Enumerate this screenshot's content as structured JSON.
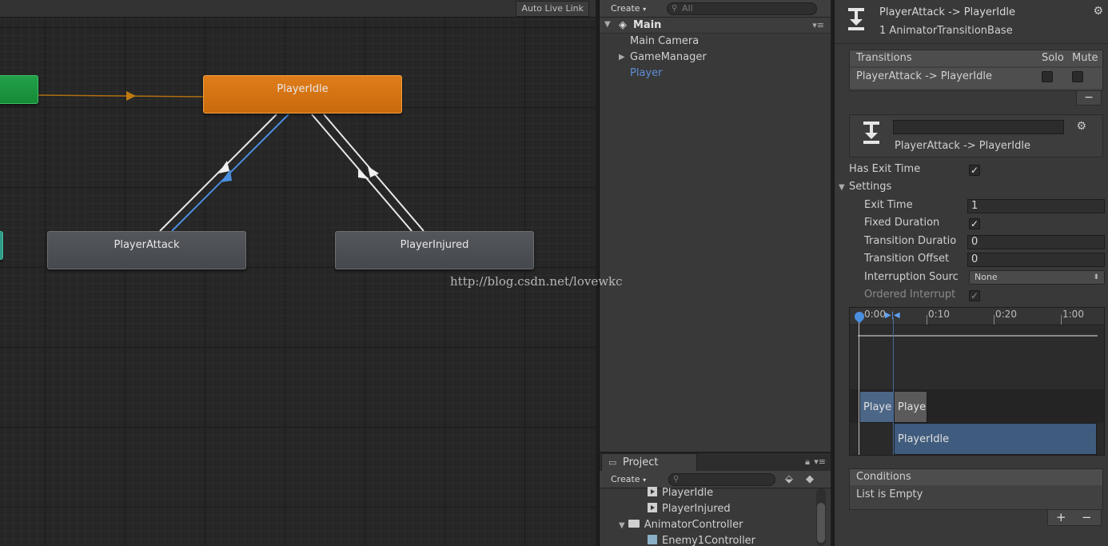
{
  "graph": {
    "auto_live_link": "Auto Live Link",
    "states": {
      "idle": "PlayerIdle",
      "attack": "PlayerAttack",
      "injured": "PlayerInjured"
    }
  },
  "hierarchy": {
    "create": "Create",
    "search_placeholder": "All",
    "scene": "Main",
    "items": [
      "Main Camera",
      "GameManager",
      "Player"
    ]
  },
  "project": {
    "tab": "Project",
    "create": "Create",
    "items": [
      "PlayerIdle",
      "PlayerInjured",
      "AnimatorController",
      "Enemy1Controller"
    ]
  },
  "inspector": {
    "title": "PlayerAttack -> PlayerIdle",
    "subtitle": "1 AnimatorTransitionBase",
    "transitions": {
      "header": "Transitions",
      "solo": "Solo",
      "mute": "Mute",
      "row": "PlayerAttack -> PlayerIdle",
      "remove": "−"
    },
    "sub_title": "PlayerAttack -> PlayerIdle",
    "has_exit_time": {
      "label": "Has Exit Time",
      "checked": true
    },
    "settings": "Settings",
    "exit_time": {
      "label": "Exit Time",
      "value": "1"
    },
    "fixed_duration": {
      "label": "Fixed Duration",
      "checked": true
    },
    "transition_duration": {
      "label": "Transition Duratio",
      "value": "0"
    },
    "transition_offset": {
      "label": "Transition Offset",
      "value": "0"
    },
    "interruption_source": {
      "label": "Interruption Sourc",
      "value": "None"
    },
    "ordered_interruption": {
      "label": "Ordered Interrupt",
      "checked": true
    },
    "timeline": {
      "ticks": [
        "0:00",
        "0:10",
        "0:20",
        "1:00"
      ],
      "clip_a": "Playe",
      "clip_b": "Playe",
      "clip_c": "PlayerIdle"
    },
    "conditions": {
      "header": "Conditions",
      "empty": "List is Empty",
      "add": "+",
      "remove": "−"
    }
  },
  "watermark": "http://blog.csdn.net/lovewkc",
  "colors": {
    "idle_state": "#d8761a",
    "default_state": "#4d5054",
    "entry_state": "#1e9a45",
    "selected_transition": "#4a8ee0",
    "selection_text": "#5e8fd8"
  }
}
